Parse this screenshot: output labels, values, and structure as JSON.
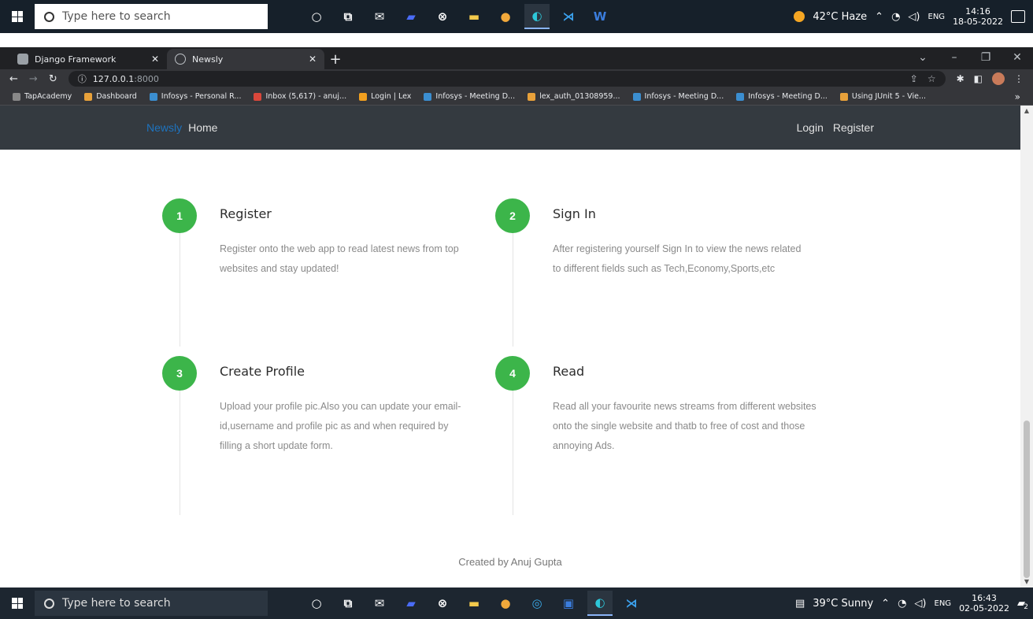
{
  "top_taskbar": {
    "search_placeholder": "Type here to search",
    "weather": "42°C Haze",
    "lang": "ENG",
    "time": "14:16",
    "date": "18-05-2022"
  },
  "browser": {
    "tabs": [
      {
        "label": "Django Framework",
        "active": false
      },
      {
        "label": "Newsly",
        "active": true
      }
    ],
    "url_host": "127.0.0.1",
    "url_port": ":8000",
    "bookmarks": [
      "TapAcademy",
      "Dashboard",
      "Infosys - Personal R...",
      "Inbox (5,617) - anuj...",
      "Login | Lex",
      "Infosys - Meeting D...",
      "lex_auth_01308959...",
      "Infosys - Meeting D...",
      "Infosys - Meeting D...",
      "Using JUnit 5 - Vie..."
    ]
  },
  "navbar": {
    "brand": "Newsly",
    "home": "Home",
    "login": "Login",
    "register": "Register"
  },
  "steps": [
    {
      "num": "1",
      "title": "Register",
      "text": "Register onto the web app to read latest news from top websites and stay updated!"
    },
    {
      "num": "2",
      "title": "Sign In",
      "text": "After registering yourself Sign In to view the news related to different fields such as Tech,Economy,Sports,etc"
    },
    {
      "num": "3",
      "title": "Create Profile",
      "text": "Upload your profile pic.Also you can update your email-id,username and profile pic as and when required by filling a short update form."
    },
    {
      "num": "4",
      "title": "Read",
      "text": "Read all your favourite news streams from different websites onto the single website and thatb to free of cost and those annoying Ads."
    }
  ],
  "footer": "Created by Anuj Gupta",
  "bottom_taskbar": {
    "search_placeholder": "Type here to search",
    "weather": "39°C Sunny",
    "lang": "ENG",
    "time": "16:43",
    "date": "02-05-2022",
    "notif_count": "2"
  },
  "colors": {
    "accent_green": "#3cb54a",
    "navbar_bg": "#343a40",
    "brand_blue": "#1e73be"
  }
}
